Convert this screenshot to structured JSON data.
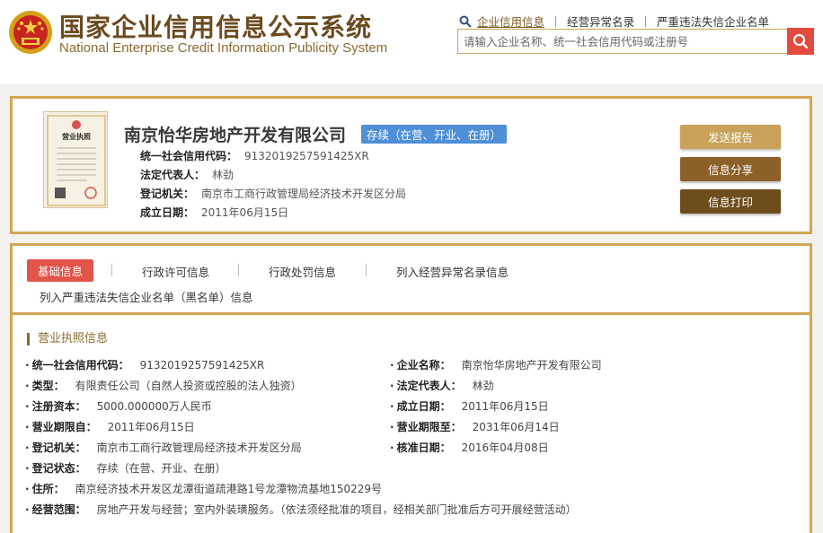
{
  "header": {
    "logo_cn": "国家企业信用信息公示系统",
    "logo_en": "National Enterprise Credit Information Publicity System",
    "nav": [
      "企业信用信息",
      "经营异常名录",
      "严重违法失信企业名单"
    ],
    "search_placeholder": "请输入企业名称、统一社会信用代码或注册号",
    "search_icon": "search-icon"
  },
  "company": {
    "name": "南京怡华房地产开发有限公司",
    "status": "存续（在营、开业、在册）",
    "fields": [
      {
        "label": "统一社会信用代码：",
        "value": "9132019257591425XR"
      },
      {
        "label": "法定代表人：",
        "value": "林劲"
      },
      {
        "label": "登记机关：",
        "value": "南京市工商行政管理局经济技术开发区分局"
      },
      {
        "label": "成立日期：",
        "value": "2011年06月15日"
      }
    ],
    "license_text": "营业执照",
    "buttons": [
      "发送报告",
      "信息分享",
      "信息打印"
    ]
  },
  "tabs": [
    "基础信息",
    "行政许可信息",
    "行政处罚信息",
    "列入经营异常名录信息",
    "列入严重违法失信企业名单（黑名单）信息"
  ],
  "section": {
    "title": "营业执照信息",
    "left": [
      {
        "label": "统一社会信用代码：",
        "value": "9132019257591425XR"
      },
      {
        "label": "类型：",
        "value": "有限责任公司（自然人投资或控股的法人独资）"
      },
      {
        "label": "注册资本：",
        "value": "5000.000000万人民币"
      },
      {
        "label": "营业期限自：",
        "value": "2011年06月15日"
      },
      {
        "label": "登记机关：",
        "value": "南京市工商行政管理局经济技术开发区分局"
      },
      {
        "label": "登记状态：",
        "value": "存续（在营、开业、在册）"
      },
      {
        "label": "住所：",
        "value": "南京经济技术开发区龙潭街道疏港路1号龙潭物流基地150229号"
      },
      {
        "label": "经营范围：",
        "value": "房地产开发与经营；室内外装璜服务。（依法须经批准的项目，经相关部门批准后方可开展经营活动）"
      }
    ],
    "right": [
      {
        "label": "企业名称：",
        "value": "南京怡华房地产开发有限公司"
      },
      {
        "label": "法定代表人：",
        "value": "林劲"
      },
      {
        "label": "成立日期：",
        "value": "2011年06月15日"
      },
      {
        "label": "营业期限至：",
        "value": "2031年06月14日"
      },
      {
        "label": "核准日期：",
        "value": "2016年04月08日"
      }
    ]
  },
  "colors": {
    "gold_border": "#d3a654",
    "brown_text": "#6b4a1e",
    "btn_send": "#c9a159",
    "btn_share": "#8b6128",
    "btn_print": "#6e4d1d",
    "active_tab": "#e2534a",
    "status_badge": "#4f8fd8",
    "search_btn": "#e24b3e"
  }
}
